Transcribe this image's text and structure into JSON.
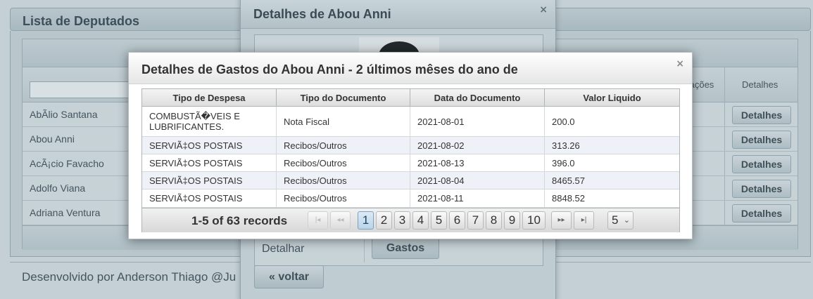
{
  "background": {
    "panel_title": "Lista de Deputados",
    "columns": [
      "tações",
      "Detalhes"
    ],
    "rows": [
      {
        "name": "AbÃlio Santana",
        "button": "Detalhes"
      },
      {
        "name": "Abou Anni",
        "button": "Detalhes"
      },
      {
        "name": "AcÃ¡cio Favacho",
        "button": "Detalhes"
      },
      {
        "name": "Adolfo Viana",
        "button": "Detalhes"
      },
      {
        "name": "Adriana Ventura",
        "button": "Detalhes"
      }
    ],
    "footer_text": "Desenvolvido por Anderson Thiago @Ju"
  },
  "details_dialog": {
    "title": "Detalhes de Abou Anni",
    "close": "×",
    "detalhar_label": "Detalhar",
    "gastos_button": "Gastos",
    "voltar_button": "« voltar"
  },
  "expenses_dialog": {
    "title": "Detalhes de Gastos do Abou Anni - 2 últimos mêses do ano de",
    "close": "×",
    "columns": [
      "Tipo de Despesa",
      "Tipo do Documento",
      "Data do Documento",
      "Valor Liquido"
    ],
    "rows": [
      [
        "COMBUSTÃ�VEIS E LUBRIFICANTES.",
        "Nota Fiscal",
        "2021-08-01",
        "200.0"
      ],
      [
        "SERVIÃ‡OS POSTAIS",
        "Recibos/Outros",
        "2021-08-02",
        "313.26"
      ],
      [
        "SERVIÃ‡OS POSTAIS",
        "Recibos/Outros",
        "2021-08-13",
        "396.0"
      ],
      [
        "SERVIÃ‡OS POSTAIS",
        "Recibos/Outros",
        "2021-08-04",
        "8465.57"
      ],
      [
        "SERVIÃ‡OS POSTAIS",
        "Recibos/Outros",
        "2021-08-11",
        "8848.52"
      ]
    ],
    "pager": {
      "records": "1-5 of 63 records",
      "first": "|◂",
      "prev": "◂◂",
      "pages": [
        "1",
        "2",
        "3",
        "4",
        "5",
        "6",
        "7",
        "8",
        "9",
        "10"
      ],
      "current_page": "1",
      "next": "▸▸",
      "last": "▸|",
      "rows_per_page": "5",
      "chevron_icon": "chevron-down-icon"
    }
  }
}
